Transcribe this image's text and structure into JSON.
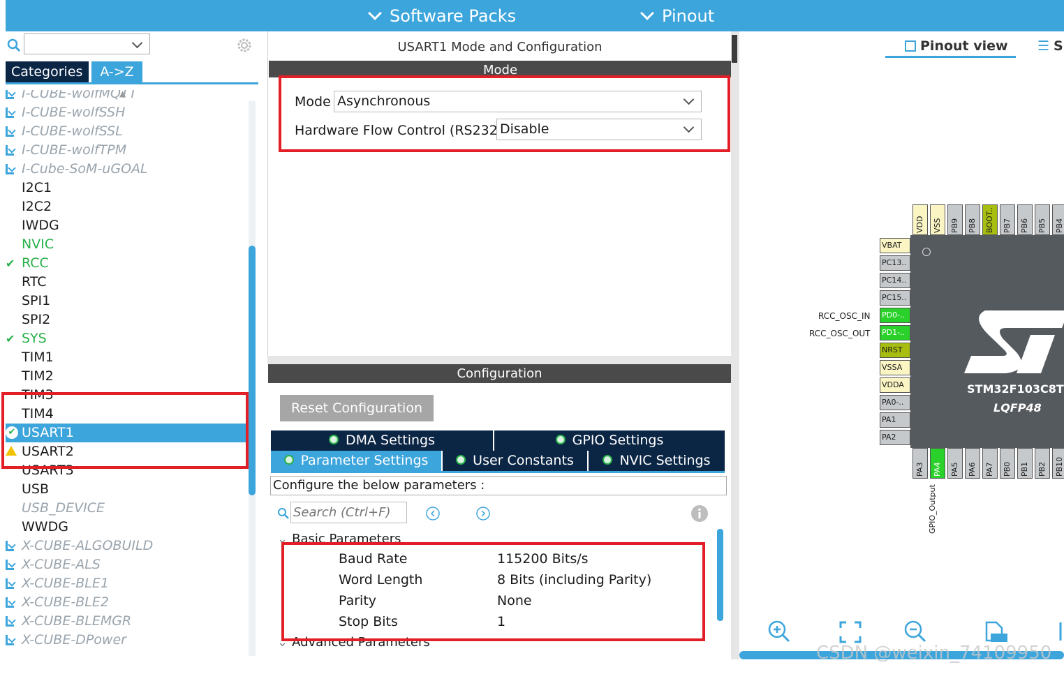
{
  "topbar": {
    "software_packs": "Software Packs",
    "pinout": "Pinout"
  },
  "left": {
    "tabs": [
      "Categories",
      "A->Z"
    ],
    "search_value": "",
    "items": [
      {
        "label": "I-CUBE-wolfMQTT",
        "style": "ext"
      },
      {
        "label": "I-CUBE-wolfSSH",
        "style": "ext"
      },
      {
        "label": "I-CUBE-wolfSSL",
        "style": "ext"
      },
      {
        "label": "I-CUBE-wolfTPM",
        "style": "ext"
      },
      {
        "label": "I-Cube-SoM-uGOAL",
        "style": "ext"
      },
      {
        "label": "I2C1",
        "style": "normal"
      },
      {
        "label": "I2C2",
        "style": "normal"
      },
      {
        "label": "IWDG",
        "style": "normal"
      },
      {
        "label": "NVIC",
        "style": "green"
      },
      {
        "label": "RCC",
        "style": "green-check"
      },
      {
        "label": "RTC",
        "style": "normal"
      },
      {
        "label": "SPI1",
        "style": "normal"
      },
      {
        "label": "SPI2",
        "style": "normal"
      },
      {
        "label": "SYS",
        "style": "green-check"
      },
      {
        "label": "TIM1",
        "style": "normal"
      },
      {
        "label": "TIM2",
        "style": "normal"
      },
      {
        "label": "TIM3",
        "style": "normal"
      },
      {
        "label": "TIM4",
        "style": "normal"
      },
      {
        "label": "USART1",
        "style": "selected"
      },
      {
        "label": "USART2",
        "style": "warn"
      },
      {
        "label": "USART3",
        "style": "normal"
      },
      {
        "label": "USB",
        "style": "normal"
      },
      {
        "label": "USB_DEVICE",
        "style": "disabled"
      },
      {
        "label": "WWDG",
        "style": "normal"
      },
      {
        "label": "X-CUBE-ALGOBUILD",
        "style": "ext"
      },
      {
        "label": "X-CUBE-ALS",
        "style": "ext"
      },
      {
        "label": "X-CUBE-BLE1",
        "style": "ext"
      },
      {
        "label": "X-CUBE-BLE2",
        "style": "ext"
      },
      {
        "label": "X-CUBE-BLEMGR",
        "style": "ext"
      },
      {
        "label": "X-CUBE-DPower",
        "style": "ext"
      }
    ]
  },
  "mode_panel": {
    "title": "USART1 Mode and Configuration",
    "section": "Mode",
    "mode_label": "Mode",
    "mode_value": "Asynchronous",
    "flow_label": "Hardware Flow Control (RS232)",
    "flow_value": "Disable"
  },
  "config_panel": {
    "section": "Configuration",
    "reset_button": "Reset Configuration",
    "tabs_row1": [
      "DMA Settings",
      "GPIO Settings"
    ],
    "tabs_row2": [
      "Parameter Settings",
      "User Constants",
      "NVIC Settings"
    ],
    "hint": "Configure the below parameters :",
    "search_placeholder": "Search (Ctrl+F)",
    "group_basic": "Basic Parameters",
    "group_advanced": "Advanced Parameters",
    "params": [
      {
        "name": "Baud Rate",
        "value": "115200 Bits/s"
      },
      {
        "name": "Word Length",
        "value": "8 Bits (including Parity)"
      },
      {
        "name": "Parity",
        "value": "None"
      },
      {
        "name": "Stop Bits",
        "value": "1"
      }
    ]
  },
  "pinout": {
    "view_tab": "Pinout view",
    "view_tab2": "S",
    "chip_name": "STM32F103C8Tx",
    "package": "LQFP48",
    "top_pins": [
      "VDD",
      "VSS",
      "PB9",
      "PB8",
      "BOOT..",
      "PB7",
      "PB6",
      "PB5",
      "PB4"
    ],
    "left_pins": [
      "VBAT",
      "PC13..",
      "PC14..",
      "PC15..",
      "PD0-..",
      "PD1-..",
      "NRST",
      "VSSA",
      "VDDA",
      "PA0-..",
      "PA1",
      "PA2"
    ],
    "left_labels": {
      "PD0": "RCC_OSC_IN",
      "PD1": "RCC_OSC_OUT"
    },
    "bottom_pins": [
      "PA3",
      "PA4",
      "PA5",
      "PA6",
      "PA7",
      "PB0",
      "PB1",
      "PB2",
      "PB10"
    ],
    "bottom_label": "GPIO_Output",
    "watermark": "CSDN @weixin_74109950"
  }
}
